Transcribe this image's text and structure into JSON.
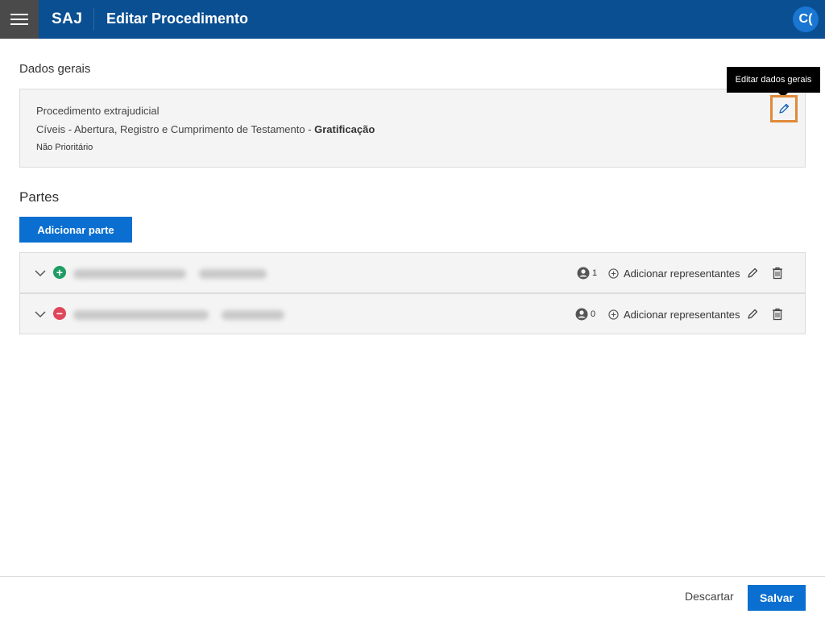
{
  "header": {
    "brand": "SAJ",
    "title": "Editar Procedimento",
    "avatar_initials": "C(",
    "colors": {
      "bar": "#0a4f92",
      "menu": "#4a4a4a"
    }
  },
  "dados_gerais": {
    "section_title": "Dados gerais",
    "line1": "Procedimento extrajudicial",
    "line2_prefix": "Cíveis - Abertura, Registro e Cumprimento de Testamento - ",
    "line2_bold": "Gratificação",
    "line3": "Não Prioritário",
    "edit_tooltip": "Editar dados gerais",
    "edit_icon": "pencil-icon"
  },
  "partes": {
    "section_title": "Partes",
    "add_button": "Adicionar parte",
    "rows": [
      {
        "status": "positive",
        "status_icon": "plus-circle-icon",
        "count": "1",
        "add_rep_label": "Adicionar representantes"
      },
      {
        "status": "negative",
        "status_icon": "minus-circle-icon",
        "count": "0",
        "add_rep_label": "Adicionar representantes"
      }
    ]
  },
  "footer": {
    "discard_label": "Descartar",
    "save_label": "Salvar",
    "accent": "#0a6fd0"
  }
}
